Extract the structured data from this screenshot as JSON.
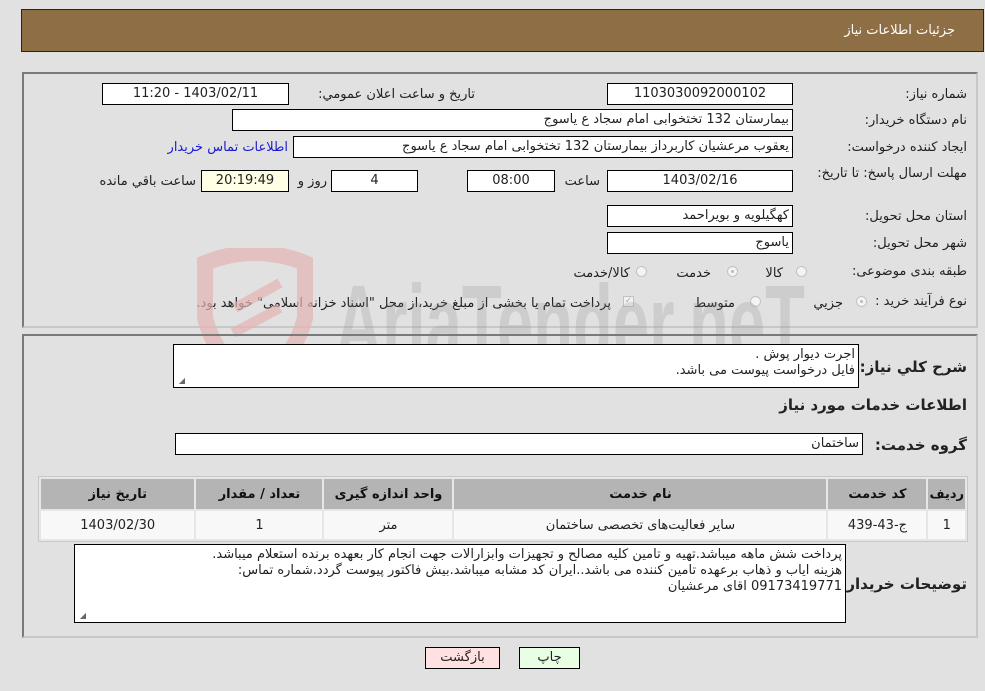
{
  "header": {
    "title": "جزئيات اطلاعات نیاز"
  },
  "form": {
    "need_number": {
      "label": "شماره نیاز:",
      "value": "1103030092000102"
    },
    "announce_datetime": {
      "label": "تاريخ و ساعت اعلان عمومي:",
      "value": "1403/02/11 - 11:20"
    },
    "buyer_org": {
      "label": "نام دستگاه خریدار:",
      "value": "بیمارستان 132 تختخوابی امام سجاد  ع  یاسوج"
    },
    "requester": {
      "label": "ایجاد کننده درخواست:",
      "value": "یعقوب مرعشیان کاربرداز بیمارستان 132 تختخوابی امام سجاد  ع  یاسوج"
    },
    "buyer_contact_link": "اطلاعات تماس خریدار",
    "deadline": {
      "label": "مهلت ارسال پاسخ: تا تاریخ:",
      "date": "1403/02/16",
      "time_label": "ساعت",
      "time": "08:00",
      "days": "4",
      "days_label": "روز و",
      "remaining": "20:19:49",
      "remaining_label": "ساعت باقي مانده"
    },
    "province": {
      "label": "استان محل تحویل:",
      "value": "کهگیلویه و بویراحمد"
    },
    "city": {
      "label": "شهر محل تحویل:",
      "value": "یاسوج"
    },
    "category": {
      "label": "طبقه بندی موضوعی:",
      "options": [
        "کالا",
        "خدمت",
        "کالا/خدمت"
      ],
      "selected": "خدمت"
    },
    "purchase_type": {
      "label": "نوع فرآیند خرید :",
      "options": [
        "جزيي",
        "متوسط"
      ],
      "selected": "جزيي",
      "treasury_checkbox_label": "پرداخت تمام یا بخشی از مبلغ خرید،از محل \"اسناد خزانه اسلامی\" خواهد بود."
    }
  },
  "description": {
    "label": "شرح کلي نياز:",
    "lines": [
      "اجرت دیوار پوش .",
      "فایل درخواست پیوست می باشد."
    ]
  },
  "services_section_title": "اطلاعات خدمات مورد نياز",
  "service_group": {
    "label": "گروه خدمت:",
    "value": "ساختمان"
  },
  "services_table": {
    "headers": [
      "رديف",
      "کد خدمت",
      "نام خدمت",
      "واحد اندازه گيری",
      "تعداد / مقدار",
      "تاريخ نياز"
    ],
    "rows": [
      [
        "1",
        "ج-43-439",
        "سایر فعالیت‌های تخصصی ساختمان",
        "متر",
        "1",
        "1403/02/30"
      ]
    ]
  },
  "buyer_notes": {
    "label": "توضيحات خريدار:",
    "lines": [
      "پرداخت شش ماهه میباشد.تهیه و تامین کلیه مصالح و تجهیزات وابزارالات جهت انجام کار بعهده برنده استعلام میباشد.",
      "هزینه ایاب و ذهاب برعهده تامین کننده می باشد..ایران کد مشابه میباشد.بیش فاکتور پیوست گردد.شماره تماس:",
      "09173419771  اقای مرعشیان"
    ]
  },
  "buttons": {
    "print": "چاپ",
    "back": "بازگشت"
  },
  "watermark": {
    "text": "AriaTender.neT"
  },
  "colors": {
    "header_bg": "#8e6e45",
    "link": "#1a1ad0",
    "back_btn": "#ffe1e1",
    "print_btn": "#e9ffe4",
    "remaining_bg": "#ffffe6"
  }
}
